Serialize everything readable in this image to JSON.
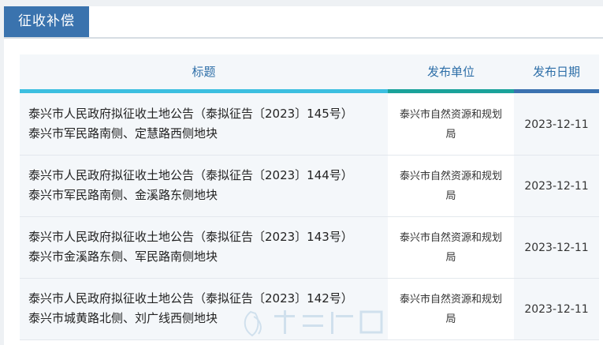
{
  "section": {
    "title": "征收补偿"
  },
  "table": {
    "headers": {
      "title": "标题",
      "unit": "发布单位",
      "date": "发布日期"
    },
    "header_colors": {
      "title_bar": "#3cbfe0",
      "unit_bar": "#1aa29a",
      "date_bar": "#3b72b0"
    },
    "rows": [
      {
        "title_line1": "泰兴市人民政府拟征收土地公告（泰拟征告〔2023〕145号）",
        "title_line2": "泰兴市军民路南侧、定慧路西侧地块",
        "unit": "泰兴市自然资源和规划局",
        "date": "2023-12-11"
      },
      {
        "title_line1": "泰兴市人民政府拟征收土地公告（泰拟征告〔2023〕144号）",
        "title_line2": "泰兴市军民路南侧、金溪路东侧地块",
        "unit": "泰兴市自然资源和规划局",
        "date": "2023-12-11"
      },
      {
        "title_line1": "泰兴市人民政府拟征收土地公告（泰拟征告〔2023〕143号）",
        "title_line2": "泰兴市金溪路东侧、军民路南侧地块",
        "unit": "泰兴市自然资源和规划局",
        "date": "2023-12-11"
      },
      {
        "title_line1": "泰兴市人民政府拟征收土地公告（泰拟征告〔2023〕142号）",
        "title_line2": "泰兴市城黄路北侧、刘广线西侧地块",
        "unit": "泰兴市自然资源和规划局",
        "date": "2023-12-11"
      }
    ]
  },
  "colors": {
    "tab_background": "#3a73ae",
    "header_text": "#2e6fa8",
    "watermark_text": "#8fb8d6"
  },
  "watermark_icon": "site-logo-watermark"
}
